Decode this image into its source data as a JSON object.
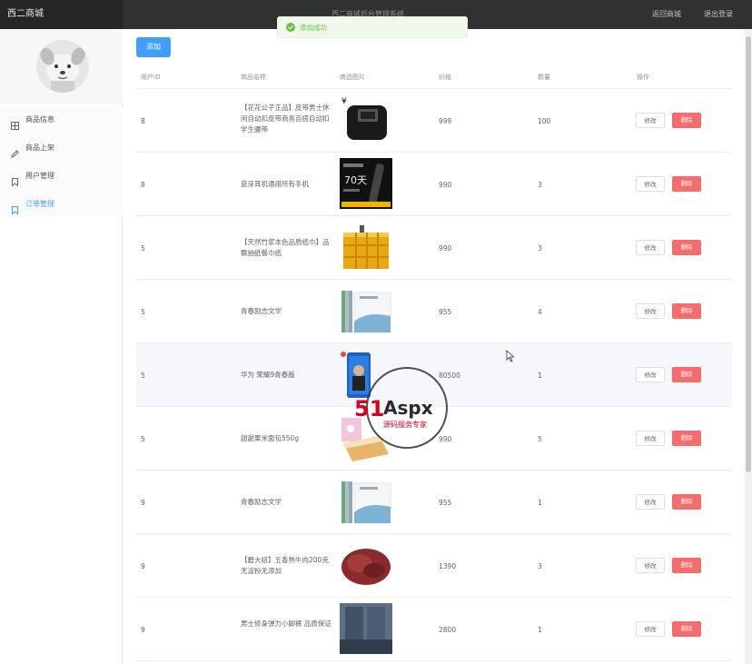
{
  "app": {
    "brand": "西二商城",
    "center_title": "西二商城后台管理系统"
  },
  "header": {
    "back_to_shop": "返回商城",
    "logout": "退出登录"
  },
  "toast": {
    "message": "添加成功"
  },
  "sidebar": {
    "items": [
      {
        "label": "商品信息",
        "icon": "grid-icon"
      },
      {
        "label": "商品上架",
        "icon": "edit-icon"
      },
      {
        "label": "用户管理",
        "icon": "bookmark-icon"
      },
      {
        "label": "订单管理",
        "icon": "bookmark-icon",
        "active": true
      }
    ]
  },
  "toolbar": {
    "add_label": "添加"
  },
  "table": {
    "columns": [
      "用户ID",
      "商品名称",
      "商品图片",
      "价格",
      "数量",
      "操作"
    ],
    "edit_label": "修改",
    "delete_label": "删除",
    "rows": [
      {
        "user_id": "8",
        "name": "【花花公子正品】皮带男士休闲自动扣皮带商务百搭自动扣学生腰带",
        "image": "belt",
        "price": "999",
        "qty": "100"
      },
      {
        "user_id": "8",
        "name": "蓝牙耳机通用所有手机",
        "image": "earphone",
        "price": "990",
        "qty": "3"
      },
      {
        "user_id": "5",
        "name": "【天然竹浆本色品质纸巾】品飘抽纸餐巾纸",
        "image": "tissue",
        "price": "990",
        "qty": "3"
      },
      {
        "user_id": "5",
        "name": "青春励志文学",
        "image": "books",
        "price": "955",
        "qty": "4"
      },
      {
        "user_id": "5",
        "name": "华为 荣耀9青春版",
        "image": "phone",
        "price": "80500",
        "qty": "1"
      },
      {
        "user_id": "5",
        "name": "甜甜果米面包550g",
        "image": "bread",
        "price": "990",
        "qty": "5"
      },
      {
        "user_id": "9",
        "name": "青春励志文学",
        "image": "books",
        "price": "955",
        "qty": "1"
      },
      {
        "user_id": "9",
        "name": "【碧大妞】五香熟牛肉200克无淀粉无添加",
        "image": "beef",
        "price": "1390",
        "qty": "3"
      },
      {
        "user_id": "9",
        "name": "男士修身弹力小脚裤 品质保证",
        "image": "jeans",
        "price": "2800",
        "qty": "1"
      }
    ]
  },
  "watermark": {
    "logo": "51Aspx",
    "tagline": "源码服务专家"
  },
  "colors": {
    "primary": "#409eff",
    "danger": "#f56c6c",
    "success": "#67c23a",
    "topbar": "#303133"
  }
}
